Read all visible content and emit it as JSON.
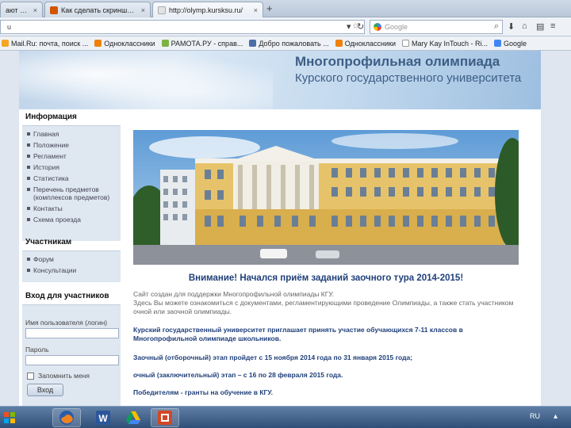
{
  "browser": {
    "tabs": [
      {
        "title": "ают эк...",
        "active": false,
        "favicon_color": "#c0392b"
      },
      {
        "title": "Как сделать скриншот — ...",
        "active": false,
        "favicon_color": "#d35400"
      },
      {
        "title": "http://olymp.kursksu.ru/",
        "active": true,
        "favicon_color": "#e3e3e3"
      }
    ],
    "new_tab_label": "+",
    "url_fragment": "u",
    "search_placeholder": "Google",
    "bookmarks": [
      {
        "label": "Mail.Ru: почта, поиск ...",
        "icon_color": "#f5a623"
      },
      {
        "label": "Одноклассники",
        "icon_color": "#ee8208"
      },
      {
        "label": "РАМОТА.РУ - справ...",
        "icon_color": "#7cb342"
      },
      {
        "label": "Добро пожаловать ...",
        "icon_color": "#4a6fa5"
      },
      {
        "label": "Одноклассники",
        "icon_color": "#ee8208"
      },
      {
        "label": "Mary Kay InTouch - Ri...",
        "icon_color": "#ffffff"
      },
      {
        "label": "Google",
        "icon_color": "#4285f4"
      }
    ]
  },
  "site": {
    "header": {
      "line1": "Многопрофильная олимпиада",
      "line2": "Курского государственного университета"
    },
    "sidebar": {
      "info_title": "Информация",
      "info_items": [
        "Главная",
        "Положение",
        "Регламент",
        "История",
        "Статистика",
        "Перечень предметов (комплексов предметов)",
        "Контакты",
        "Схема проезда"
      ],
      "participants_title": "Участникам",
      "participants_items": [
        "Форум",
        "Консультации"
      ],
      "login_title": "Вход для участников",
      "login_label": "Имя пользователя (логин)",
      "password_label": "Пароль",
      "remember_label": "Запомнить меня",
      "login_button": "Вход"
    },
    "main": {
      "attention": "Внимание! Начался приём заданий заочного тура 2014-2015!",
      "intro_1": "Сайт создан для поддержки Многопрофильной олимпиады КГУ.",
      "intro_2": "Здесь Вы можете ознакомиться с документами, регламентирующими проведение Олимпиады, а также стать участником очной или заочной олимпиады.",
      "invite": "Курский государственный университет приглашает принять участие обучающихся 7-11 классов в Многопрофильной олимпиаде школьников.",
      "stage1": "Заочный (отборочный) этап пройдет с 15 ноября 2014 года по 31 января 2015 года;",
      "stage2": "очный (заключительный) этап – с 16 по 28 февраля 2015 года.",
      "winners": "Победителям - гранты на обучение в КГУ."
    }
  },
  "taskbar": {
    "apps": [
      "firefox",
      "word",
      "google-drive",
      "powerpoint"
    ],
    "language": "RU"
  }
}
